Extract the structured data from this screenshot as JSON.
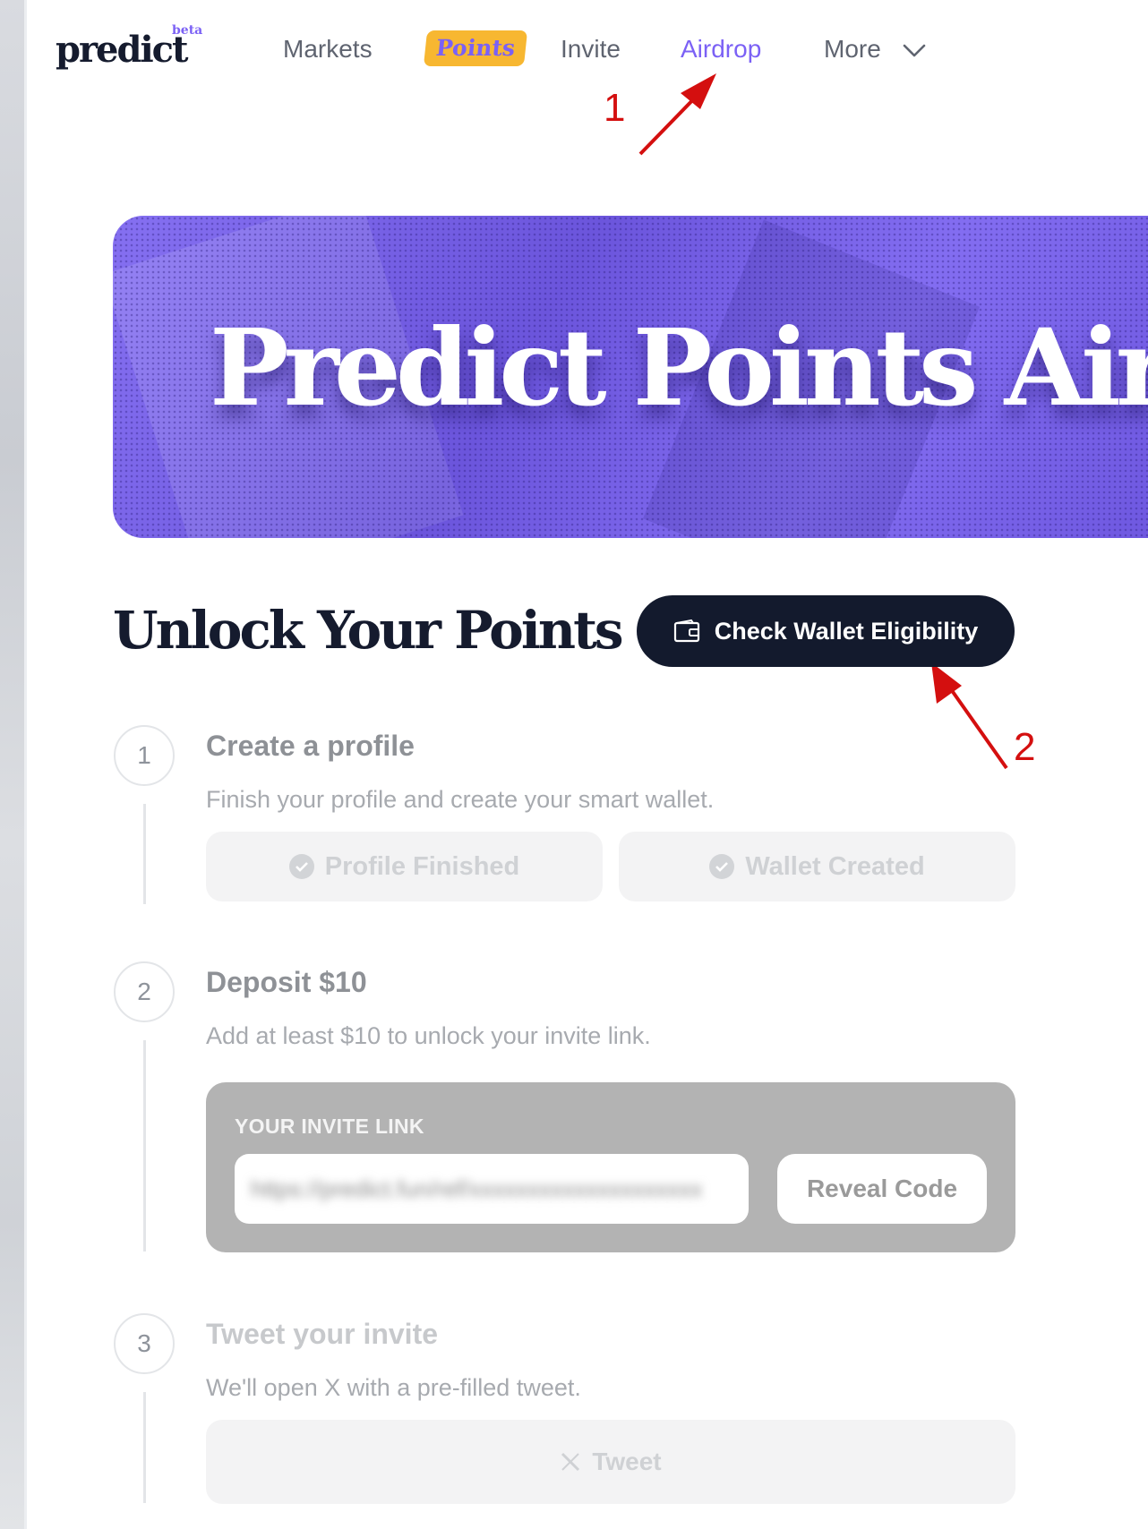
{
  "nav": {
    "logo": "predict",
    "beta": "beta",
    "markets": "Markets",
    "points": "Points",
    "invite": "Invite",
    "airdrop": "Airdrop",
    "more": "More"
  },
  "annotations": {
    "one": "1",
    "two": "2",
    "color": "#d40f0f"
  },
  "banner": {
    "title": "Predict Points Aird"
  },
  "section": {
    "title": "Unlock Your Points",
    "check_button": "Check Wallet Eligibility"
  },
  "steps": [
    {
      "number": "1",
      "title": "Create a profile",
      "desc": "Finish your profile and create your smart wallet.",
      "buttons": [
        "Profile Finished",
        "Wallet Created"
      ]
    },
    {
      "number": "2",
      "title": "Deposit $10",
      "desc": "Add at least $10 to unlock your invite link.",
      "invite_label": "YOUR INVITE LINK",
      "invite_value": "https://predict.fun/ref/xxxxxxxxxxxxxxxxxxxx",
      "reveal_button": "Reveal Code"
    },
    {
      "number": "3",
      "title": "Tweet your invite",
      "desc": "We'll open X with a pre-filled tweet.",
      "tweet_button": "Tweet"
    }
  ],
  "colors": {
    "accent": "#7b61f5",
    "points_bg": "#f7b731",
    "dark": "#131a2d"
  }
}
